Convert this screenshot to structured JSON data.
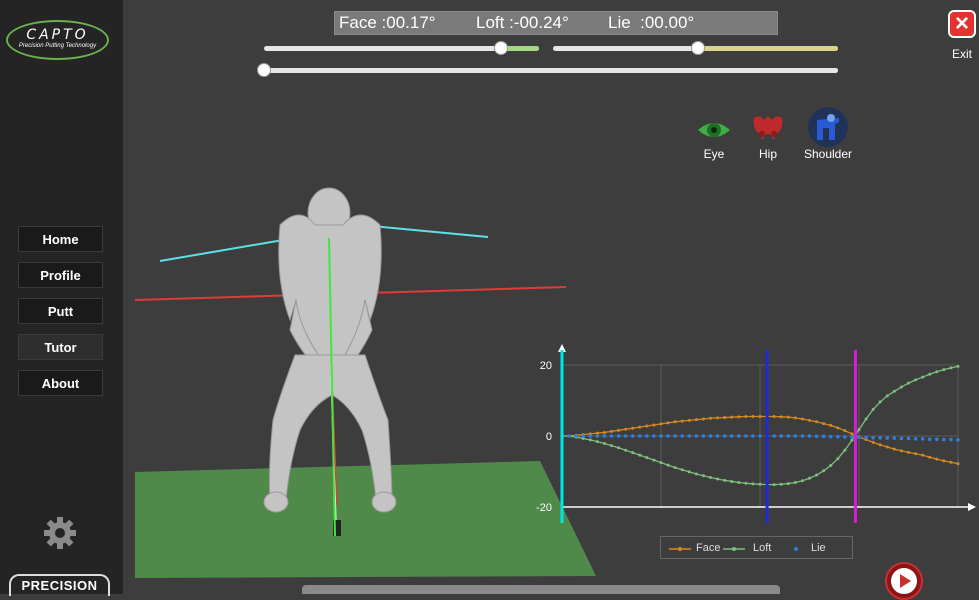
{
  "logo": {
    "title": "CAPTO",
    "tagline": "Precision Putting Technology"
  },
  "nav": [
    {
      "label": "Home",
      "active": false
    },
    {
      "label": "Profile",
      "active": false
    },
    {
      "label": "Putt",
      "active": false
    },
    {
      "label": "Tutor",
      "active": true
    },
    {
      "label": "About",
      "active": false
    }
  ],
  "brand": "PRECISION",
  "readout": {
    "face": "Face :00.17°",
    "loft": "Loft :-00.24°",
    "lie": "Lie  :00.00°"
  },
  "sliders": [
    {
      "name": "slider-1",
      "value": 0.86,
      "fill_color": "#a6d785"
    },
    {
      "name": "slider-2",
      "value": 0.51,
      "fill_color": "#d8d48a"
    },
    {
      "name": "slider-timeline",
      "value": 0.0,
      "fill_color": "#e6e6e6"
    }
  ],
  "exit_label": "Exit",
  "views": [
    {
      "label": "Eye",
      "icon": "eye-icon",
      "color": "#3fae49"
    },
    {
      "label": "Hip",
      "icon": "hip-icon",
      "color": "#c0292b"
    },
    {
      "label": "Shoulder",
      "icon": "shoulder-icon",
      "color": "#2a5bd7"
    }
  ],
  "chart_data": {
    "type": "line",
    "ylim": [
      -20,
      20
    ],
    "yticks": [
      "20",
      "0",
      "-20"
    ],
    "xlim": [
      0,
      56
    ],
    "grid": true,
    "legend": "bottom-center",
    "markers": [
      {
        "color": "#00e5e5",
        "x": 0
      },
      {
        "color": "#1f2ad8",
        "x": 29
      },
      {
        "color": "#d41ed4",
        "x": 41.5
      }
    ],
    "series": [
      {
        "name": "Face",
        "color": "#d4891f",
        "values": [
          0,
          0,
          0.2,
          0.4,
          0.6,
          0.8,
          1.0,
          1.3,
          1.6,
          1.9,
          2.2,
          2.5,
          2.8,
          3.1,
          3.4,
          3.7,
          4.0,
          4.2,
          4.4,
          4.6,
          4.8,
          5.0,
          5.1,
          5.2,
          5.3,
          5.4,
          5.5,
          5.5,
          5.5,
          5.5,
          5.5,
          5.4,
          5.3,
          5.1,
          4.8,
          4.4,
          4.0,
          3.5,
          3.0,
          2.3,
          1.5,
          0.6,
          -0.3,
          -1.0,
          -1.8,
          -2.5,
          -3.1,
          -3.7,
          -4.2,
          -4.6,
          -5.0,
          -5.4,
          -6.0,
          -6.5,
          -7.0,
          -7.4,
          -7.8
        ]
      },
      {
        "name": "Loft",
        "color": "#7dbf7d",
        "values": [
          0,
          0,
          -0.3,
          -0.7,
          -1.1,
          -1.6,
          -2.1,
          -2.7,
          -3.3,
          -4.0,
          -4.7,
          -5.4,
          -6.1,
          -6.8,
          -7.5,
          -8.2,
          -8.9,
          -9.5,
          -10.1,
          -10.7,
          -11.2,
          -11.7,
          -12.1,
          -12.5,
          -12.8,
          -13.1,
          -13.3,
          -13.5,
          -13.6,
          -13.7,
          -13.7,
          -13.6,
          -13.4,
          -13.1,
          -12.6,
          -11.9,
          -11.0,
          -9.8,
          -8.3,
          -6.4,
          -4.0,
          -1.2,
          1.8,
          4.8,
          7.5,
          9.6,
          11.3,
          12.6,
          13.8,
          14.9,
          15.8,
          16.6,
          17.4,
          18.1,
          18.7,
          19.2,
          19.6
        ]
      },
      {
        "name": "Lie",
        "color": "#2f7de0",
        "values": [
          0,
          0,
          0,
          0,
          0,
          0,
          0,
          0,
          0,
          0,
          0,
          0,
          0,
          0,
          0,
          0,
          0,
          0,
          0,
          0,
          0,
          0,
          0,
          0,
          0,
          0,
          0,
          0,
          0,
          0,
          0,
          0,
          0,
          0,
          0,
          0,
          -0.1,
          -0.1,
          -0.2,
          -0.2,
          -0.3,
          -0.3,
          -0.4,
          -0.4,
          -0.5,
          -0.5,
          -0.6,
          -0.6,
          -0.7,
          -0.7,
          -0.8,
          -0.8,
          -0.9,
          -0.9,
          -1.0,
          -1.0,
          -1.1
        ]
      }
    ]
  }
}
